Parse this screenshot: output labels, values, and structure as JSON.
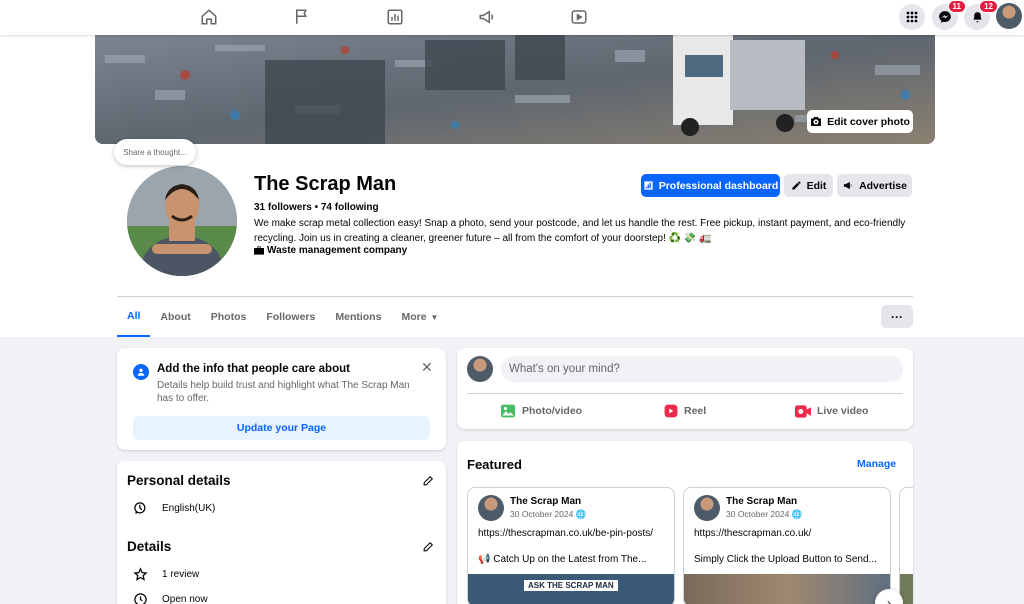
{
  "topnav": {
    "icons": [
      "home-icon",
      "flag-icon",
      "insights-icon",
      "megaphone-icon",
      "video-icon"
    ],
    "messenger_badge": "11",
    "notifications_badge": "12"
  },
  "cover": {
    "edit_label": "Edit cover photo"
  },
  "share_bubble": "Share a thought...",
  "profile": {
    "name": "The Scrap Man",
    "stats": "31 followers • 74 following",
    "description": "We make scrap metal collection easy! Snap a photo, send your postcode, and let us handle the rest. Free pickup, instant payment, and eco-friendly recycling. Join us in creating a cleaner, greener future – all from the comfort of your doorstep! ♻️ 💸 🚛",
    "category": "Waste management company"
  },
  "actions": {
    "dashboard": "Professional dashboard",
    "edit": "Edit",
    "advertise": "Advertise"
  },
  "tabs": [
    {
      "label": "All"
    },
    {
      "label": "About"
    },
    {
      "label": "Photos"
    },
    {
      "label": "Followers"
    },
    {
      "label": "Mentions"
    },
    {
      "label": "More"
    }
  ],
  "more_dots": "···",
  "info_card": {
    "title": "Add the info that people care about",
    "desc": "Details help build trust and highlight what The Scrap Man has to offer.",
    "button": "Update your Page"
  },
  "personal": {
    "title": "Personal details",
    "language": "English(UK)"
  },
  "details": {
    "title": "Details",
    "review": "1 review",
    "open": "Open now"
  },
  "composer": {
    "placeholder": "What's on your mind?",
    "photo": "Photo/video",
    "reel": "Reel",
    "live": "Live video"
  },
  "featured": {
    "title": "Featured",
    "manage": "Manage",
    "posts": [
      {
        "author": "The Scrap Man",
        "date": "30 October 2024",
        "url": "https://thescrapman.co.uk/be-pin-posts/",
        "text": "📢 Catch Up on the Latest from The...",
        "banner": "ASK THE SCRAP MAN"
      },
      {
        "author": "The Scrap Man",
        "date": "30 October 2024",
        "url": "https://thescrapman.co.uk/",
        "text": "Simply Click the Upload Button to Send..."
      }
    ]
  },
  "colors": {
    "accent": "#0866ff",
    "badge": "#e41e3f",
    "page_bg": "#f0f2f5"
  }
}
